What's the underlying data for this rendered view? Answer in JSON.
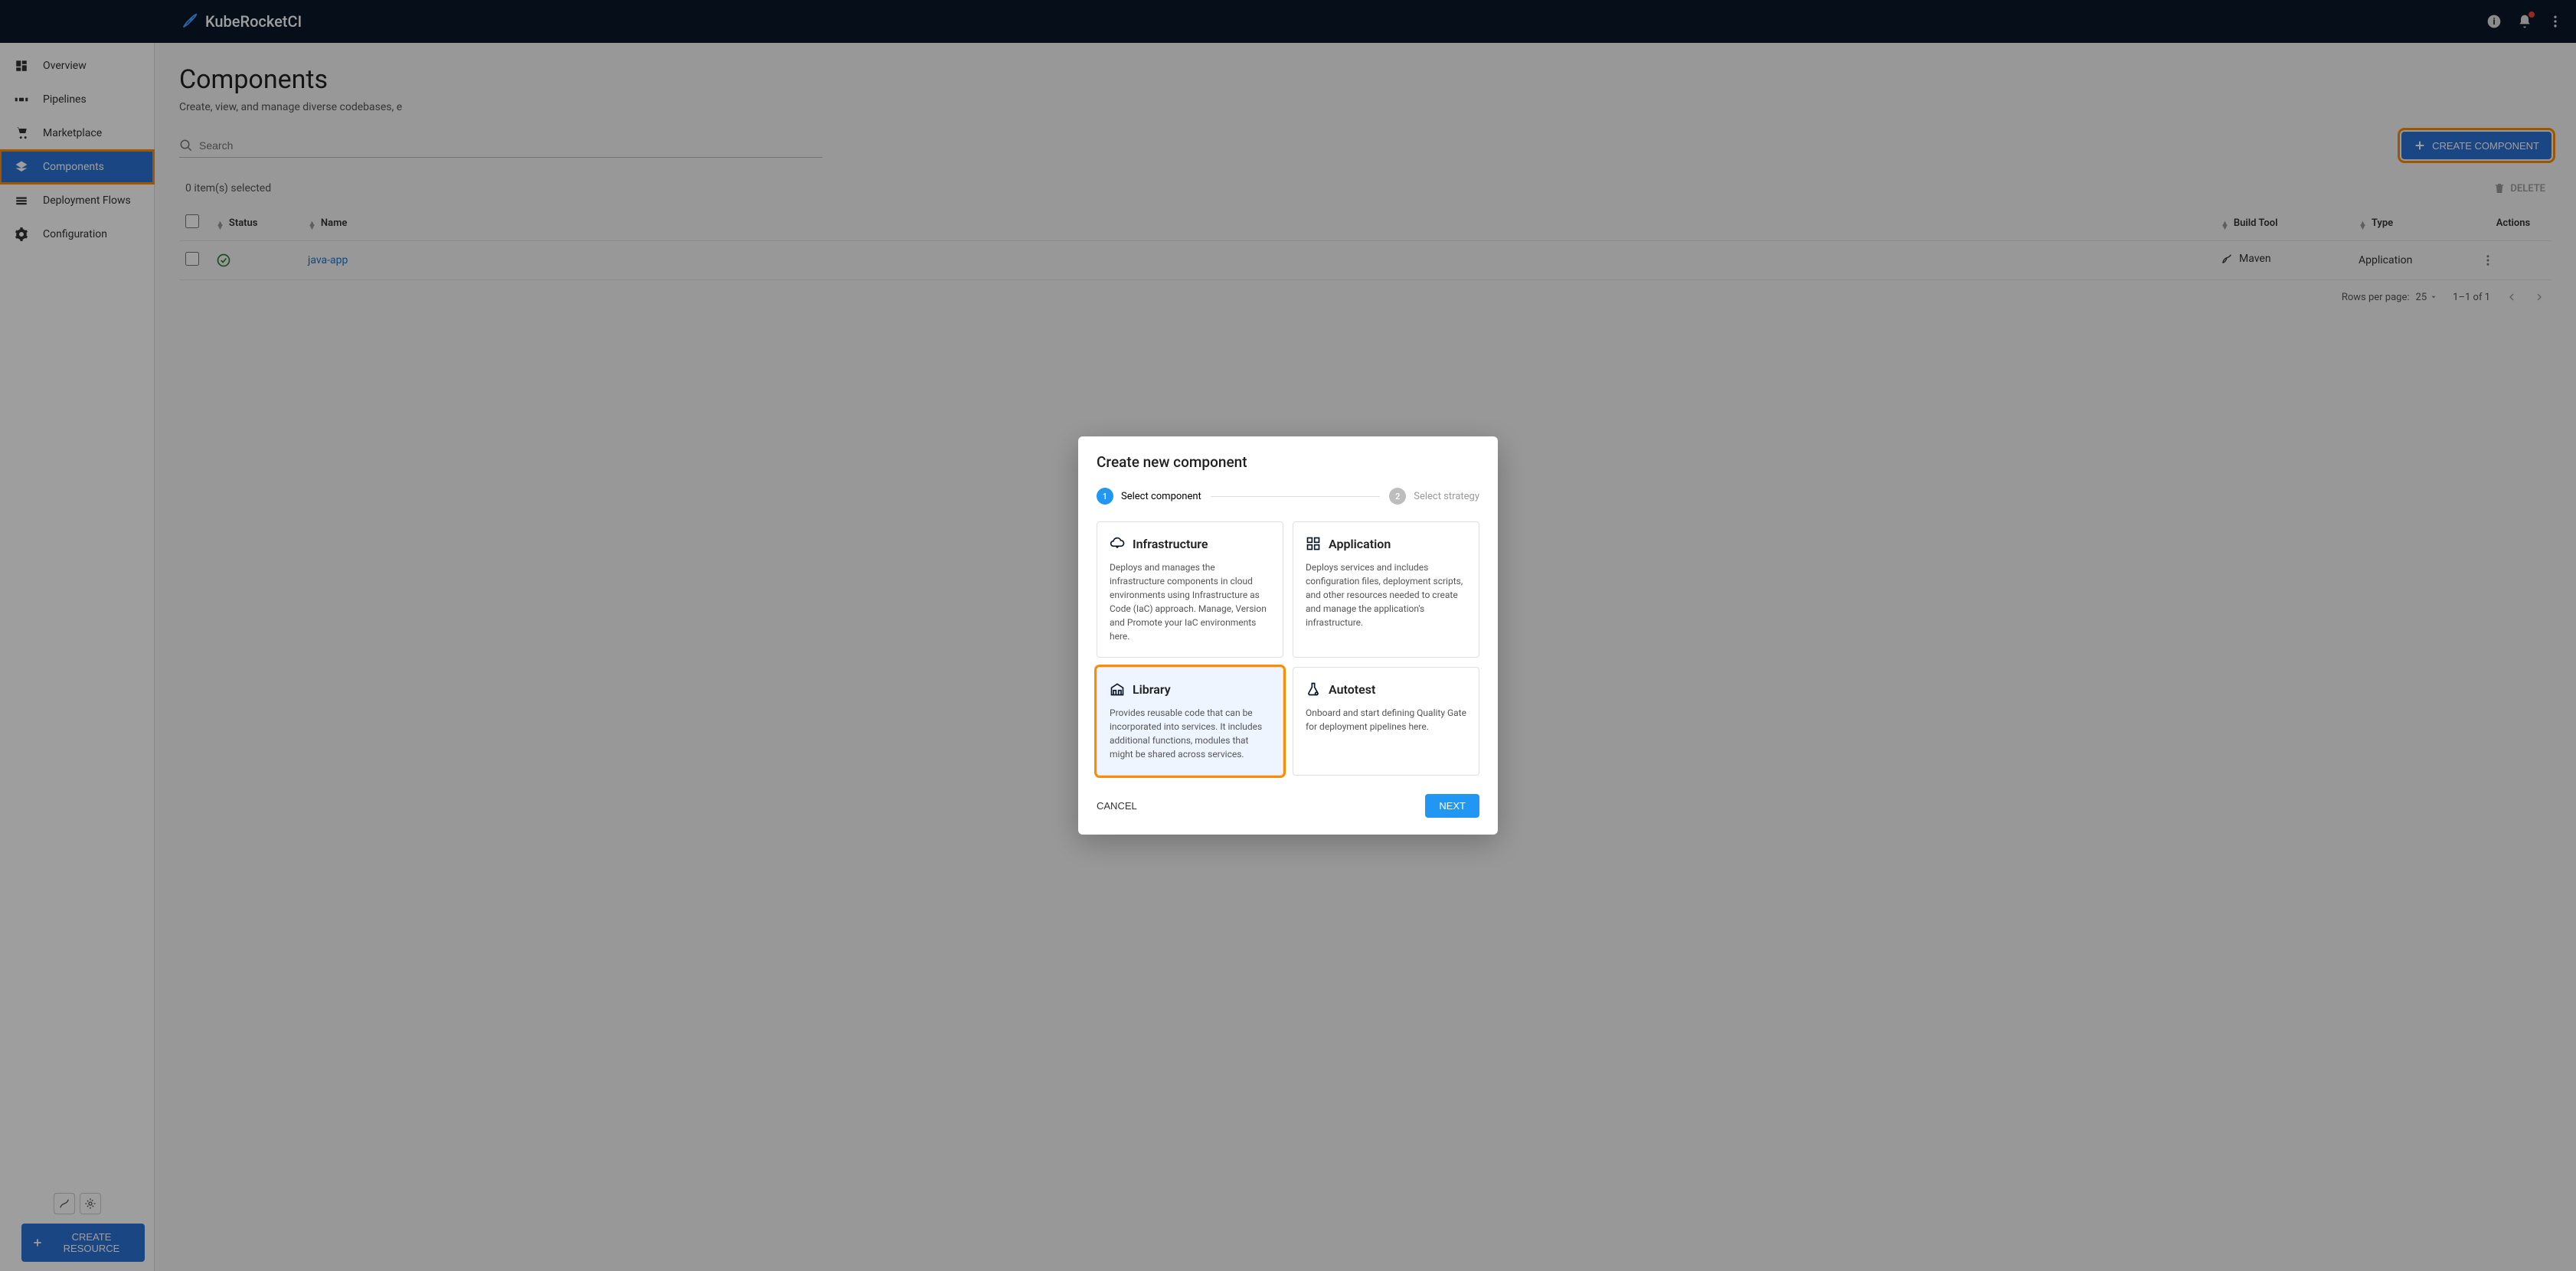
{
  "app": {
    "title": "KubeRocketCI"
  },
  "sidebar": {
    "items": [
      {
        "label": "Overview"
      },
      {
        "label": "Pipelines"
      },
      {
        "label": "Marketplace"
      },
      {
        "label": "Components"
      },
      {
        "label": "Deployment Flows"
      },
      {
        "label": "Configuration"
      }
    ],
    "create_resource": "CREATE RESOURCE"
  },
  "page": {
    "title": "Components",
    "subtitle": "Create, view, and manage diverse codebases, e",
    "subtitle_link_trail": "."
  },
  "toolbar": {
    "search_placeholder": "Search",
    "create_button": "CREATE COMPONENT"
  },
  "selection": {
    "text": "0 item(s) selected",
    "delete": "DELETE"
  },
  "table": {
    "headers": {
      "status": "Status",
      "name": "Name",
      "build_tool": "Build Tool",
      "type": "Type",
      "actions": "Actions"
    },
    "rows": [
      {
        "name": "java-app",
        "build_tool": "Maven",
        "type": "Application"
      }
    ]
  },
  "pagination": {
    "rows_label": "Rows per page:",
    "page_size": "25",
    "range": "1–1 of 1"
  },
  "modal": {
    "title": "Create new component",
    "steps": {
      "step1": "Select component",
      "step2": "Select strategy"
    },
    "options": {
      "infrastructure": {
        "title": "Infrastructure",
        "desc": "Deploys and manages the infrastructure components in cloud environments using Infrastructure as Code (IaC) approach. Manage, Version and Promote your IaC environments here."
      },
      "application": {
        "title": "Application",
        "desc": "Deploys services and includes configuration files, deployment scripts, and other resources needed to create and manage the application's infrastructure."
      },
      "library": {
        "title": "Library",
        "desc": "Provides reusable code that can be incorporated into services. It includes additional functions, modules that might be shared across services."
      },
      "autotest": {
        "title": "Autotest",
        "desc": "Onboard and start defining Quality Gate for deployment pipelines here."
      }
    },
    "cancel": "CANCEL",
    "next": "NEXT"
  }
}
